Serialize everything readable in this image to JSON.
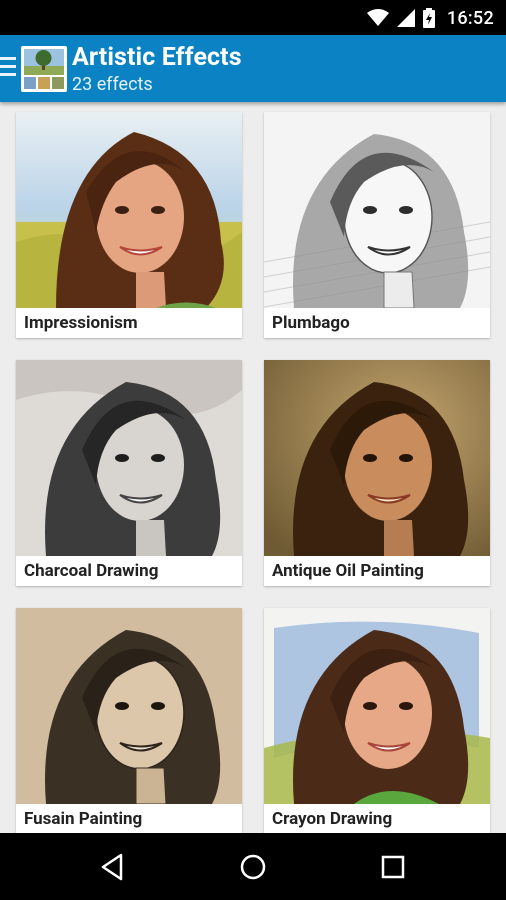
{
  "status_bar": {
    "time": "16:52",
    "icons": [
      "wifi-icon",
      "cell-signal-icon",
      "battery-charging-icon"
    ]
  },
  "app_bar": {
    "title": "Artistic Effects",
    "subtitle": "23 effects",
    "icons": [
      "menu-icon",
      "app-logo"
    ]
  },
  "effects": [
    {
      "label": "Impressionism",
      "style": "impressionism"
    },
    {
      "label": "Plumbago",
      "style": "plumbago"
    },
    {
      "label": "Charcoal Drawing",
      "style": "charcoal"
    },
    {
      "label": "Antique Oil Painting",
      "style": "antique-oil"
    },
    {
      "label": "Fusain Painting",
      "style": "fusain"
    },
    {
      "label": "Crayon Drawing",
      "style": "crayon"
    }
  ],
  "nav_bar": {
    "icons": [
      "back-icon",
      "home-icon",
      "recents-icon"
    ]
  },
  "colors": {
    "app_bar": "#0a82c4",
    "background": "#ededed",
    "status_bar": "#000000"
  }
}
